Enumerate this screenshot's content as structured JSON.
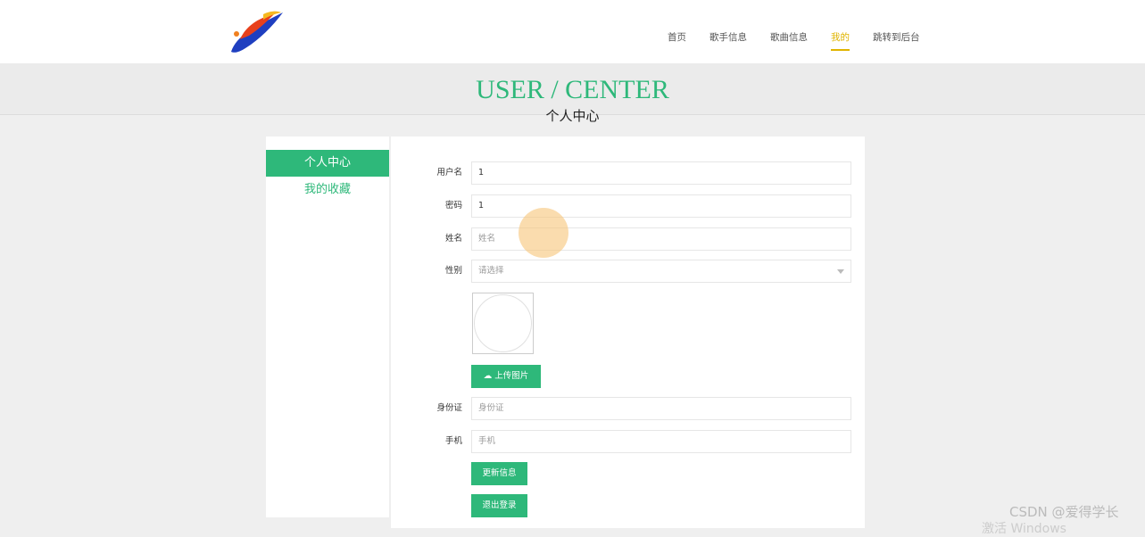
{
  "nav": {
    "items": [
      {
        "label": "首页"
      },
      {
        "label": "歌手信息"
      },
      {
        "label": "歌曲信息"
      },
      {
        "label": "我的",
        "active": true
      },
      {
        "label": "跳转到后台"
      }
    ],
    "active_color": "#e0b400"
  },
  "banner": {
    "title_en": "USER / CENTER",
    "title_cn": "个人中心"
  },
  "sidebar": {
    "items": [
      {
        "label": "个人中心"
      },
      {
        "label": "我的收藏"
      }
    ],
    "accent": "#2eb87a"
  },
  "form": {
    "username": {
      "label": "用户名",
      "value": "1"
    },
    "password": {
      "label": "密码",
      "value": "1"
    },
    "name": {
      "label": "姓名",
      "placeholder": "姓名"
    },
    "gender": {
      "label": "性别",
      "placeholder": "请选择"
    },
    "upload_label": "上传图片",
    "idcard": {
      "label": "身份证",
      "placeholder": "身份证"
    },
    "phone": {
      "label": "手机",
      "placeholder": "手机"
    },
    "update_label": "更新信息",
    "logout_label": "退出登录"
  },
  "watermark": "CSDN @爱得学长",
  "windows_watermark": "激活 Windows"
}
